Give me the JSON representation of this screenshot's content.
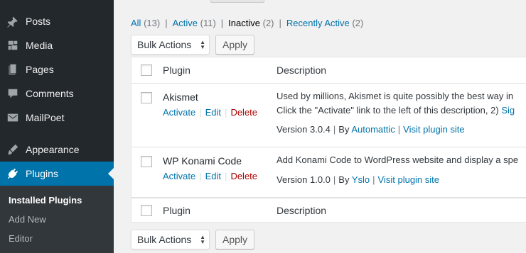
{
  "sidebar": {
    "items": [
      {
        "label": "Posts",
        "icon": "pin-icon"
      },
      {
        "label": "Media",
        "icon": "media-icon"
      },
      {
        "label": "Pages",
        "icon": "pages-icon"
      },
      {
        "label": "Comments",
        "icon": "comments-icon"
      },
      {
        "label": "MailPoet",
        "icon": "mail-icon"
      },
      {
        "label": "Appearance",
        "icon": "brush-icon"
      },
      {
        "label": "Plugins",
        "icon": "plug-icon"
      }
    ],
    "submenu": [
      "Installed Plugins",
      "Add New",
      "Editor"
    ]
  },
  "filters": [
    {
      "label": "All",
      "count": "(13)"
    },
    {
      "label": "Active",
      "count": "(11)"
    },
    {
      "label": "Inactive",
      "count": "(2)"
    },
    {
      "label": "Recently Active",
      "count": "(2)"
    }
  ],
  "separator": "|",
  "bulk_actions": {
    "label": "Bulk Actions",
    "apply": "Apply"
  },
  "table": {
    "col_plugin": "Plugin",
    "col_description": "Description",
    "plugins": [
      {
        "name": "Akismet",
        "actions": {
          "activate": "Activate",
          "edit": "Edit",
          "delete": "Delete"
        },
        "description_line1": "Used by millions, Akismet is quite possibly the best way in",
        "description_line2": "Click the \"Activate\" link to the left of this description, 2)",
        "description_link": "Sig",
        "version": "Version 3.0.4",
        "by": "By",
        "author": "Automattic",
        "site": "Visit plugin site"
      },
      {
        "name": "WP Konami Code",
        "actions": {
          "activate": "Activate",
          "edit": "Edit",
          "delete": "Delete"
        },
        "description_line1": "Add Konami Code to WordPress website and display a spe",
        "version": "Version 1.0.0",
        "by": "By",
        "author": "Yslo",
        "site": "Visit plugin site"
      }
    ]
  },
  "colors": {
    "sidebar_bg": "#23282d",
    "submenu_bg": "#32373c",
    "accent": "#0073aa",
    "delete": "#a00"
  }
}
